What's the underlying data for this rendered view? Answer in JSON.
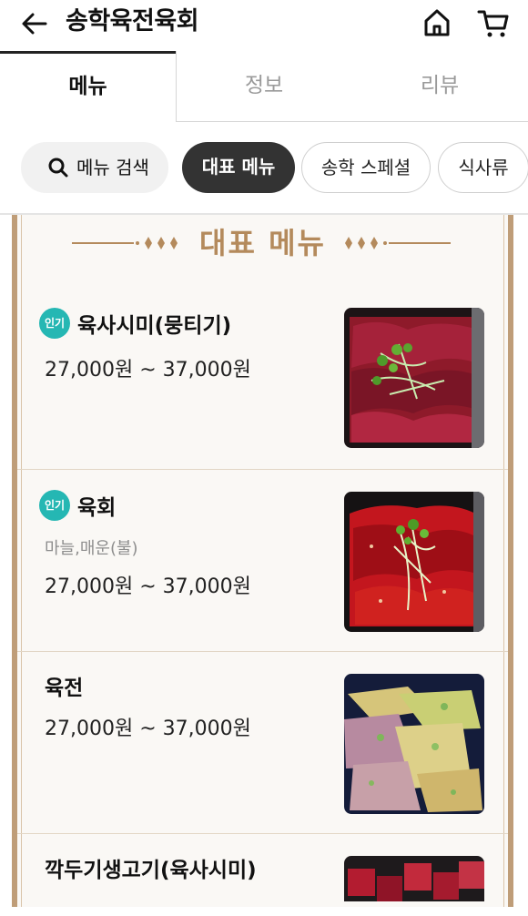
{
  "header": {
    "title": "송학육전육회",
    "back_icon": "arrow-left-icon",
    "home_icon": "home-icon",
    "cart_icon": "cart-icon"
  },
  "tabs": [
    {
      "label": "메뉴",
      "active": true
    },
    {
      "label": "정보",
      "active": false
    },
    {
      "label": "리뷰",
      "active": false
    }
  ],
  "chips": {
    "search_label": "메뉴 검색",
    "items": [
      {
        "label": "대표 메뉴",
        "active": true
      },
      {
        "label": "송학 스페셜",
        "active": false
      },
      {
        "label": "식사류",
        "active": false
      }
    ]
  },
  "section": {
    "title": "대표 메뉴",
    "accent_color": "#b48a5c"
  },
  "menu_items": [
    {
      "badge": "인기",
      "name": "육사시미(뭉티기)",
      "desc": "",
      "price": "27,000원 ~ 37,000원",
      "image": "raw-beef-slices"
    },
    {
      "badge": "인기",
      "name": "육회",
      "desc": "마늘,매운(불)",
      "price": "27,000원 ~ 37,000원",
      "image": "spicy-beef-tartare"
    },
    {
      "badge": "",
      "name": "육전",
      "desc": "",
      "price": "27,000원 ~ 37,000원",
      "image": "beef-pancakes"
    },
    {
      "badge": "",
      "name": "깍두기생고기(육사시미)",
      "desc": "",
      "price": "",
      "image": "diced-raw-beef"
    }
  ],
  "colors": {
    "badge": "#25b7b3",
    "active_chip": "#333333",
    "board_frame": "#bf9d78"
  }
}
